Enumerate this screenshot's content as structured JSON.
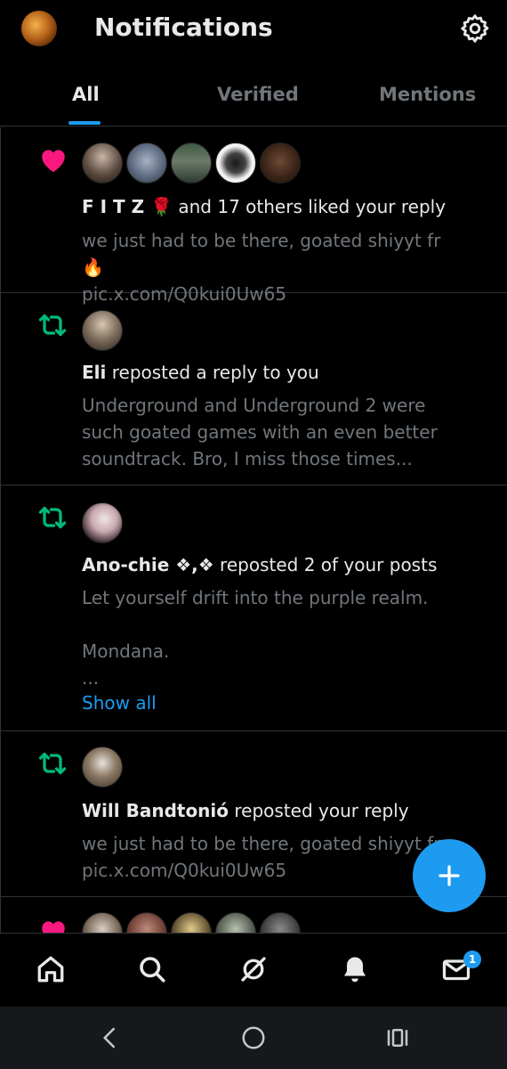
{
  "header": {
    "title": "Notifications"
  },
  "tabs": [
    {
      "label": "All"
    },
    {
      "label": "Verified"
    },
    {
      "label": "Mentions"
    }
  ],
  "notifications": [
    {
      "kind": "like",
      "actor": "F I T Z 🌹",
      "action": " and 17 others liked your reply",
      "body": "we just had to be there, goated shiyyt fr 🔥\npic.x.com/Q0kui0Uw65"
    },
    {
      "kind": "repost",
      "actor": "Eli",
      "action": " reposted a reply to you",
      "body": "Underground and Underground 2 were\nsuch goated games with an even better\nsoundtrack. Bro, I miss those times..."
    },
    {
      "kind": "repost",
      "actor": "Ano-chie ❖,❖",
      "action": " reposted 2 of your posts",
      "body": "Let yourself drift into the purple realm.\n\nMondana.\n...",
      "show_all": "Show all"
    },
    {
      "kind": "repost",
      "actor": "Will Bandtonió",
      "action": " reposted your reply",
      "body": "we just had to be there, goated shiyyt fr\npic.x.com/Q0kui0Uw65"
    }
  ],
  "messages_badge": "1",
  "colors": {
    "accent": "#1d9bf0",
    "like": "#f91880",
    "repost": "#00ba7c",
    "muted": "#71767b"
  }
}
